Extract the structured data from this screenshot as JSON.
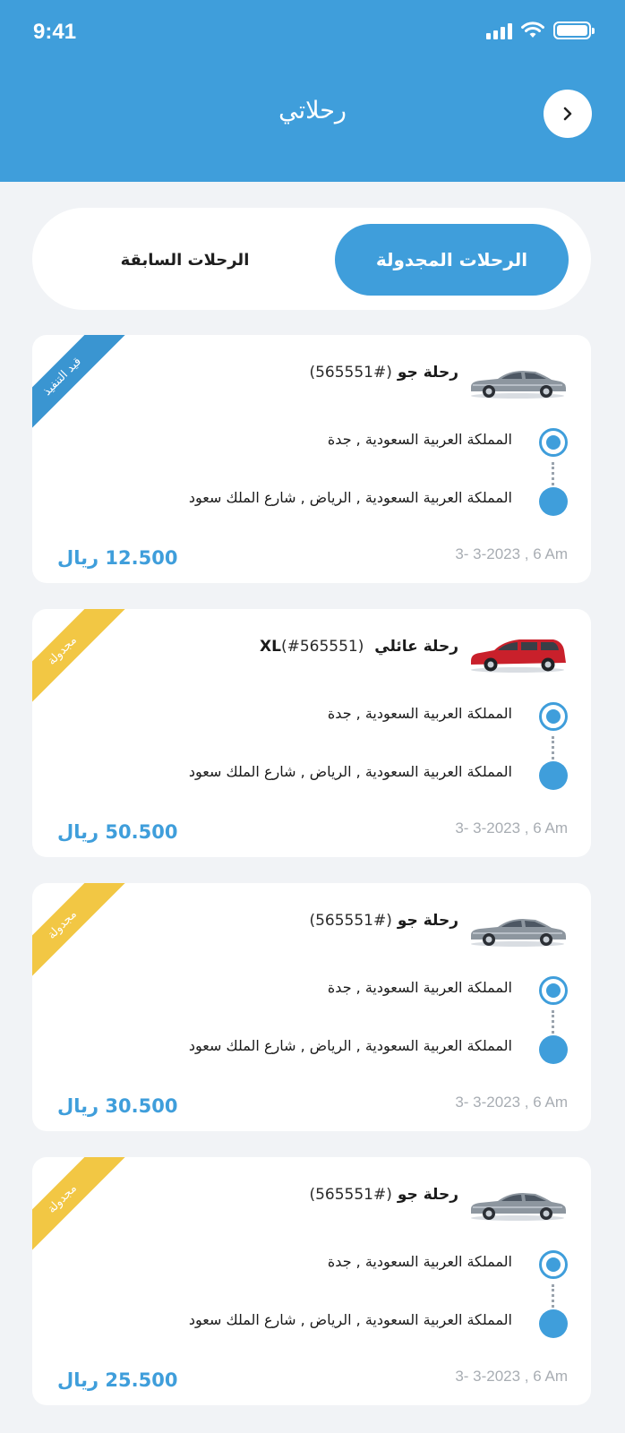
{
  "status_bar": {
    "time": "9:41"
  },
  "header": {
    "title": "رحلاتي"
  },
  "tabs": {
    "active": "الرحلات المجدولة",
    "inactive": "الرحلات السابقة"
  },
  "colors": {
    "primary": "#3f9edb",
    "ribbon_in_progress": "#3a95d1",
    "ribbon_scheduled": "#f2c744"
  },
  "trips": [
    {
      "status": "قيد التنفيذ",
      "status_color": "blue",
      "car": "silver-sedan",
      "name": "رحلة جو",
      "number": "(#565551)",
      "from": "المملكة العربية السعودية , جدة",
      "to": "المملكة العربية السعودية , الرياض , شارع الملك سعود",
      "datetime": "3- 3-2023 , 6 Am",
      "price": "12.500 ريال"
    },
    {
      "status": "مجدولة",
      "status_color": "yellow",
      "car": "red-hatchback",
      "name": "رحلة عائلي XL",
      "number": "(#565551)",
      "from": "المملكة العربية السعودية , جدة",
      "to": "المملكة العربية السعودية , الرياض , شارع الملك سعود",
      "datetime": "3- 3-2023 , 6 Am",
      "price": "50.500 ريال"
    },
    {
      "status": "مجدولة",
      "status_color": "yellow",
      "car": "silver-sedan",
      "name": "رحلة جو",
      "number": "(#565551)",
      "from": "المملكة العربية السعودية , جدة",
      "to": "المملكة العربية السعودية , الرياض , شارع الملك سعود",
      "datetime": "3- 3-2023 , 6 Am",
      "price": "30.500 ريال"
    },
    {
      "status": "مجدولة",
      "status_color": "yellow",
      "car": "silver-sedan",
      "name": "رحلة جو",
      "number": "(#565551)",
      "from": "المملكة العربية السعودية , جدة",
      "to": "المملكة العربية السعودية , الرياض , شارع الملك سعود",
      "datetime": "3- 3-2023 , 6 Am",
      "price": "25.500 ريال"
    }
  ]
}
